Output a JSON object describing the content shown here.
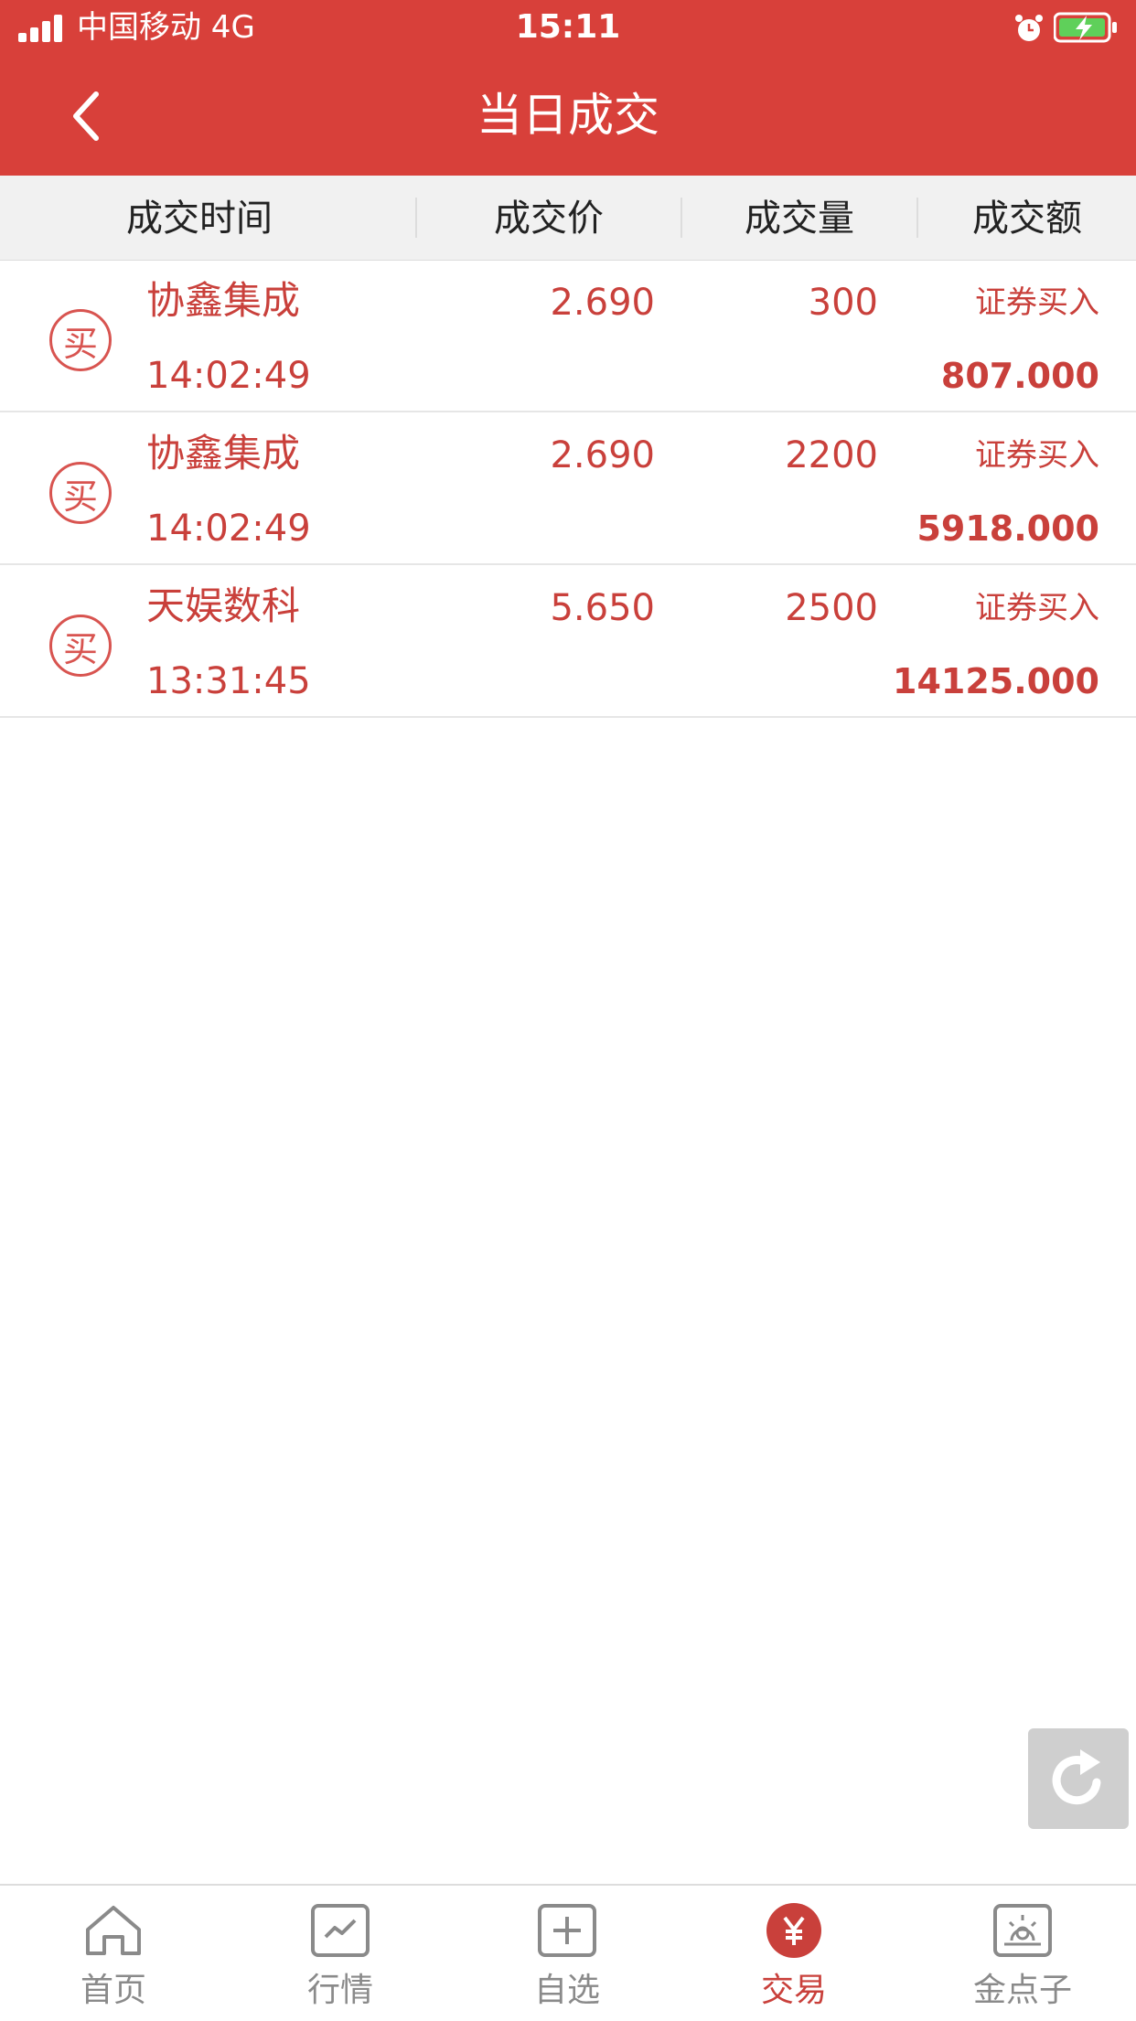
{
  "status_bar": {
    "carrier": "中国移动  4G",
    "time": "15:11"
  },
  "nav": {
    "title": "当日成交"
  },
  "columns": [
    "成交时间",
    "成交价",
    "成交量",
    "成交额"
  ],
  "trades": [
    {
      "name": "协鑫集成",
      "time": "14:02:49",
      "price": "2.690",
      "quantity": "300",
      "type": "证券买入",
      "amount": "807.000",
      "badge": "买"
    },
    {
      "name": "协鑫集成",
      "time": "14:02:49",
      "price": "2.690",
      "quantity": "2200",
      "type": "证券买入",
      "amount": "5918.000",
      "badge": "买"
    },
    {
      "name": "天娱数科",
      "time": "13:31:45",
      "price": "5.650",
      "quantity": "2500",
      "type": "证券买入",
      "amount": "14125.000",
      "badge": "买"
    }
  ],
  "tabs": [
    {
      "label": "首页",
      "icon": "home-icon"
    },
    {
      "label": "行情",
      "icon": "chart-icon"
    },
    {
      "label": "自选",
      "icon": "plus-box-icon"
    },
    {
      "label": "交易",
      "icon": "yen-icon",
      "active": true
    },
    {
      "label": "金点子",
      "icon": "idea-icon"
    }
  ],
  "colors": {
    "brand_red": "#d8403a",
    "trade_text": "#c9403b",
    "tab_inactive": "#8a8a8a"
  }
}
